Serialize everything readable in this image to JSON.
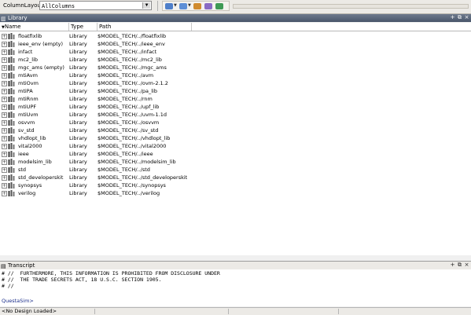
{
  "toolbar": {
    "column_layout_label": "ColumnLayout",
    "column_layout_value": "AllColumns",
    "icons": [
      "sim-icon",
      "compile-icon",
      "refresh-icon",
      "compile-all-icon",
      "break-icon"
    ]
  },
  "library_pane": {
    "title": "Library",
    "columns": [
      "Name",
      "Type",
      "Path"
    ],
    "rows": [
      {
        "name": "floatfixlib",
        "type": "Library",
        "path": "$MODEL_TECH/../floatfixlib"
      },
      {
        "name": "ieee_env (empty)",
        "type": "Library",
        "path": "$MODEL_TECH/../ieee_env"
      },
      {
        "name": "infact",
        "type": "Library",
        "path": "$MODEL_TECH/../infact"
      },
      {
        "name": "mc2_lib",
        "type": "Library",
        "path": "$MODEL_TECH/../mc2_lib"
      },
      {
        "name": "mgc_ams (empty)",
        "type": "Library",
        "path": "$MODEL_TECH/../mgc_ams"
      },
      {
        "name": "mtiAvm",
        "type": "Library",
        "path": "$MODEL_TECH/../avm"
      },
      {
        "name": "mtiOvm",
        "type": "Library",
        "path": "$MODEL_TECH/../ovm-2.1.2"
      },
      {
        "name": "mtiPA",
        "type": "Library",
        "path": "$MODEL_TECH/../pa_lib"
      },
      {
        "name": "mtiRnm",
        "type": "Library",
        "path": "$MODEL_TECH/../rnm"
      },
      {
        "name": "mtiUPF",
        "type": "Library",
        "path": "$MODEL_TECH/../upf_lib"
      },
      {
        "name": "mtiUvm",
        "type": "Library",
        "path": "$MODEL_TECH/../uvm-1.1d"
      },
      {
        "name": "osvvm",
        "type": "Library",
        "path": "$MODEL_TECH/../osvvm"
      },
      {
        "name": "sv_std",
        "type": "Library",
        "path": "$MODEL_TECH/../sv_std"
      },
      {
        "name": "vhdlopt_lib",
        "type": "Library",
        "path": "$MODEL_TECH/../vhdlopt_lib"
      },
      {
        "name": "vital2000",
        "type": "Library",
        "path": "$MODEL_TECH/../vital2000"
      },
      {
        "name": "ieee",
        "type": "Library",
        "path": "$MODEL_TECH/../ieee"
      },
      {
        "name": "modelsim_lib",
        "type": "Library",
        "path": "$MODEL_TECH/../modelsim_lib"
      },
      {
        "name": "std",
        "type": "Library",
        "path": "$MODEL_TECH/../std"
      },
      {
        "name": "std_developerskit",
        "type": "Library",
        "path": "$MODEL_TECH/../std_developerskit"
      },
      {
        "name": "synopsys",
        "type": "Library",
        "path": "$MODEL_TECH/../synopsys"
      },
      {
        "name": "verilog",
        "type": "Library",
        "path": "$MODEL_TECH/../verilog"
      }
    ]
  },
  "transcript_pane": {
    "title": "Transcript",
    "lines": [
      "# //  FURTHERMORE, THIS INFORMATION IS PROHIBITED FROM DISCLOSURE UNDER",
      "# //  THE TRADE SECRETS ACT, 18 U.S.C. SECTION 1905.",
      "# //"
    ],
    "prompt": "QuestaSim>"
  },
  "status_bar": {
    "design_status": "<No Design Loaded>"
  },
  "colors": {
    "title_bar": "#56627a",
    "library_icon": "#3a3a3a",
    "prompt_text": "#1a2d8a"
  }
}
